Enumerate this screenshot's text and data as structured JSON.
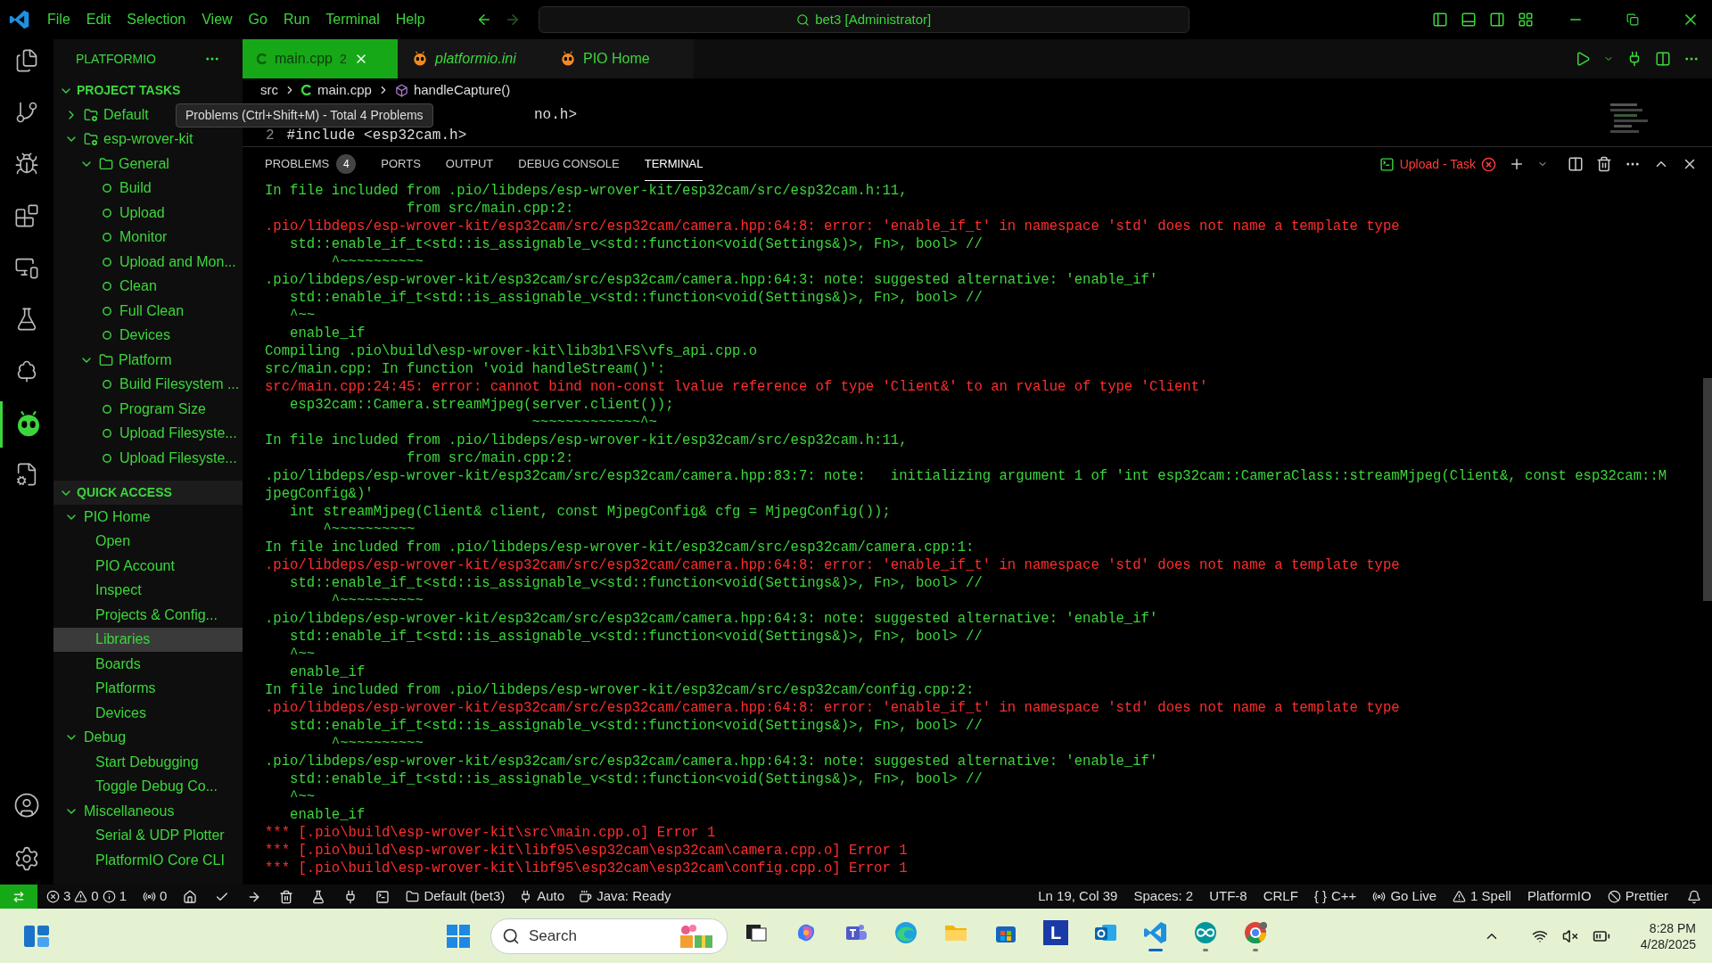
{
  "menu": [
    "File",
    "Edit",
    "Selection",
    "View",
    "Go",
    "Run",
    "Terminal",
    "Help"
  ],
  "command_center": "bet3 [Administrator]",
  "sidebar": {
    "title": "PLATFORMIO",
    "sections": [
      {
        "title": "PROJECT TASKS",
        "expanded": true,
        "items": [
          {
            "kind": "env",
            "label": "Default",
            "expanded": false,
            "selected": false
          },
          {
            "kind": "env",
            "label": "esp-wrover-kit",
            "expanded": true,
            "selected": false,
            "children": [
              {
                "kind": "folder",
                "label": "General",
                "expanded": true,
                "selected": false,
                "children": [
                  {
                    "kind": "task",
                    "label": "Build",
                    "selected": false
                  },
                  {
                    "kind": "task",
                    "label": "Upload",
                    "selected": false
                  },
                  {
                    "kind": "task",
                    "label": "Monitor",
                    "selected": false
                  },
                  {
                    "kind": "task",
                    "label": "Upload and Mon...",
                    "selected": false
                  },
                  {
                    "kind": "task",
                    "label": "Clean",
                    "selected": false
                  },
                  {
                    "kind": "task",
                    "label": "Full Clean",
                    "selected": false
                  },
                  {
                    "kind": "task",
                    "label": "Devices",
                    "selected": false
                  }
                ]
              },
              {
                "kind": "folder",
                "label": "Platform",
                "expanded": true,
                "selected": false,
                "children": [
                  {
                    "kind": "task",
                    "label": "Build Filesystem ...",
                    "selected": false
                  },
                  {
                    "kind": "task",
                    "label": "Program Size",
                    "selected": false
                  },
                  {
                    "kind": "task",
                    "label": "Upload Filesyste...",
                    "selected": false
                  },
                  {
                    "kind": "task",
                    "label": "Upload Filesyste...",
                    "selected": false
                  }
                ]
              }
            ]
          }
        ]
      },
      {
        "title": "QUICK ACCESS",
        "expanded": true,
        "items": [
          {
            "kind": "group",
            "label": "PIO Home",
            "expanded": true,
            "selected": false,
            "children": [
              {
                "kind": "link",
                "label": "Open",
                "selected": false
              },
              {
                "kind": "link",
                "label": "PIO Account",
                "selected": false
              },
              {
                "kind": "link",
                "label": "Inspect",
                "selected": false
              },
              {
                "kind": "link",
                "label": "Projects & Config...",
                "selected": false
              },
              {
                "kind": "link",
                "label": "Libraries",
                "selected": true
              },
              {
                "kind": "link",
                "label": "Boards",
                "selected": false
              },
              {
                "kind": "link",
                "label": "Platforms",
                "selected": false
              },
              {
                "kind": "link",
                "label": "Devices",
                "selected": false
              }
            ]
          },
          {
            "kind": "group",
            "label": "Debug",
            "expanded": true,
            "selected": false,
            "children": [
              {
                "kind": "link",
                "label": "Start Debugging",
                "selected": false
              },
              {
                "kind": "link",
                "label": "Toggle Debug Co...",
                "selected": false
              }
            ]
          },
          {
            "kind": "group",
            "label": "Miscellaneous",
            "expanded": true,
            "selected": false,
            "children": [
              {
                "kind": "link",
                "label": "Serial & UDP Plotter",
                "selected": false
              },
              {
                "kind": "link",
                "label": "PlatformIO Core CLI",
                "selected": false
              }
            ]
          }
        ]
      }
    ]
  },
  "editor_tabs": [
    {
      "kind": "cpp",
      "label": "main.cpp",
      "badge": "2",
      "selected": true,
      "preview": false
    },
    {
      "kind": "pio",
      "label": "platformio.ini",
      "selected": false,
      "preview": true
    },
    {
      "kind": "pio",
      "label": "PIO Home",
      "selected": false,
      "preview": false
    }
  ],
  "breadcrumb": [
    "src",
    "main.cpp",
    "handleCapture()"
  ],
  "editor_lines": [
    {
      "text": "no.h>"
    },
    {
      "number": "2",
      "text": "#include <esp32cam.h>"
    }
  ],
  "tooltip": "Problems (Ctrl+Shift+M) - Total 4 Problems",
  "panel_tabs": [
    {
      "label": "PROBLEMS",
      "badge": "4",
      "selected": false
    },
    {
      "label": "PORTS",
      "selected": false
    },
    {
      "label": "OUTPUT",
      "selected": false
    },
    {
      "label": "DEBUG CONSOLE",
      "selected": false
    },
    {
      "label": "TERMINAL",
      "selected": true
    }
  ],
  "terminal_task": "Upload - Task",
  "terminal": [
    {
      "kind": "normal",
      "text": "In file included from .pio/libdeps/esp-wrover-kit/esp32cam/src/esp32cam.h:11,"
    },
    {
      "kind": "normal",
      "text": "                 from src/main.cpp:2:"
    },
    {
      "kind": "error",
      "text": ".pio/libdeps/esp-wrover-kit/esp32cam/src/esp32cam/camera.hpp:64:8: error: 'enable_if_t' in namespace 'std' does not name a template type"
    },
    {
      "kind": "normal",
      "text": "   std::enable_if_t<std::is_assignable_v<std::function<void(Settings&)>, Fn>, bool> //"
    },
    {
      "kind": "normal",
      "text": "        ^~~~~~~~~~~"
    },
    {
      "kind": "normal",
      "text": ".pio/libdeps/esp-wrover-kit/esp32cam/src/esp32cam/camera.hpp:64:3: note: suggested alternative: 'enable_if'"
    },
    {
      "kind": "normal",
      "text": "   std::enable_if_t<std::is_assignable_v<std::function<void(Settings&)>, Fn>, bool> //"
    },
    {
      "kind": "normal",
      "text": "   ^~~"
    },
    {
      "kind": "normal",
      "text": "   enable_if"
    },
    {
      "kind": "normal",
      "text": "Compiling .pio\\build\\esp-wrover-kit\\lib3b1\\FS\\vfs_api.cpp.o"
    },
    {
      "kind": "normal",
      "text": "src/main.cpp: In function 'void handleStream()':"
    },
    {
      "kind": "error",
      "text": "src/main.cpp:24:45: error: cannot bind non-const lvalue reference of type 'Client&' to an rvalue of type 'Client'"
    },
    {
      "kind": "normal",
      "text": "   esp32cam::Camera.streamMjpeg(server.client());"
    },
    {
      "kind": "normal",
      "text": "                                ~~~~~~~~~~~~~^~"
    },
    {
      "kind": "normal",
      "text": "In file included from .pio/libdeps/esp-wrover-kit/esp32cam/src/esp32cam.h:11,"
    },
    {
      "kind": "normal",
      "text": "                 from src/main.cpp:2:"
    },
    {
      "kind": "normal",
      "text": ".pio/libdeps/esp-wrover-kit/esp32cam/src/esp32cam/camera.hpp:83:7: note:   initializing argument 1 of 'int esp32cam::CameraClass::streamMjpeg(Client&, const esp32cam::M"
    },
    {
      "kind": "normal",
      "text": "jpegConfig&)'"
    },
    {
      "kind": "normal",
      "text": "   int streamMjpeg(Client& client, const MjpegConfig& cfg = MjpegConfig());"
    },
    {
      "kind": "normal",
      "text": "       ^~~~~~~~~~~"
    },
    {
      "kind": "normal",
      "text": "In file included from .pio/libdeps/esp-wrover-kit/esp32cam/src/esp32cam/camera.cpp:1:"
    },
    {
      "kind": "error",
      "text": ".pio/libdeps/esp-wrover-kit/esp32cam/src/esp32cam/camera.hpp:64:8: error: 'enable_if_t' in namespace 'std' does not name a template type"
    },
    {
      "kind": "normal",
      "text": "   std::enable_if_t<std::is_assignable_v<std::function<void(Settings&)>, Fn>, bool> //"
    },
    {
      "kind": "normal",
      "text": "        ^~~~~~~~~~~"
    },
    {
      "kind": "normal",
      "text": ".pio/libdeps/esp-wrover-kit/esp32cam/src/esp32cam/camera.hpp:64:3: note: suggested alternative: 'enable_if'"
    },
    {
      "kind": "normal",
      "text": "   std::enable_if_t<std::is_assignable_v<std::function<void(Settings&)>, Fn>, bool> //"
    },
    {
      "kind": "normal",
      "text": "   ^~~"
    },
    {
      "kind": "normal",
      "text": "   enable_if"
    },
    {
      "kind": "normal",
      "text": "In file included from .pio/libdeps/esp-wrover-kit/esp32cam/src/esp32cam/config.cpp:2:"
    },
    {
      "kind": "error",
      "text": ".pio/libdeps/esp-wrover-kit/esp32cam/src/esp32cam/camera.hpp:64:8: error: 'enable_if_t' in namespace 'std' does not name a template type"
    },
    {
      "kind": "normal",
      "text": "   std::enable_if_t<std::is_assignable_v<std::function<void(Settings&)>, Fn>, bool> //"
    },
    {
      "kind": "normal",
      "text": "        ^~~~~~~~~~~"
    },
    {
      "kind": "normal",
      "text": ".pio/libdeps/esp-wrover-kit/esp32cam/src/esp32cam/camera.hpp:64:3: note: suggested alternative: 'enable_if'"
    },
    {
      "kind": "normal",
      "text": "   std::enable_if_t<std::is_assignable_v<std::function<void(Settings&)>, Fn>, bool> //"
    },
    {
      "kind": "normal",
      "text": "   ^~~"
    },
    {
      "kind": "normal",
      "text": "   enable_if"
    },
    {
      "kind": "error",
      "text": "*** [.pio\\build\\esp-wrover-kit\\src\\main.cpp.o] Error 1"
    },
    {
      "kind": "error",
      "text": "*** [.pio\\build\\esp-wrover-kit\\libf95\\esp32cam\\esp32cam\\camera.cpp.o] Error 1"
    },
    {
      "kind": "error",
      "text": "*** [.pio\\build\\esp-wrover-kit\\libf95\\esp32cam\\esp32cam\\config.cpp.o] Error 1"
    }
  ],
  "status_bar": {
    "errors": "3",
    "warnings": "0",
    "infos": "1",
    "ports": "0",
    "env": "Default (bet3)",
    "auto": "Auto",
    "java": "Java: Ready",
    "right": [
      {
        "kind": "text",
        "label": "Ln 19, Col 39"
      },
      {
        "kind": "text",
        "label": "Spaces: 2"
      },
      {
        "kind": "text",
        "label": "UTF-8"
      },
      {
        "kind": "text",
        "label": "CRLF"
      },
      {
        "kind": "braces",
        "icon": "{ }",
        "label": "C++"
      },
      {
        "kind": "live",
        "label": "Go Live"
      },
      {
        "kind": "warn",
        "label": "1 Spell"
      },
      {
        "kind": "text",
        "label": "PlatformIO"
      },
      {
        "kind": "prettier",
        "label": "Prettier"
      }
    ]
  },
  "taskbar": {
    "search_placeholder": "Search",
    "time": "8:28 PM",
    "date": "4/28/2025",
    "apps": [
      {
        "kind": "taskview",
        "running": false
      },
      {
        "kind": "copilot",
        "running": false
      },
      {
        "kind": "teams",
        "running": false
      },
      {
        "kind": "edge",
        "running": false
      },
      {
        "kind": "explorer",
        "running": false
      },
      {
        "kind": "store",
        "running": false
      },
      {
        "kind": "letter",
        "label": "L",
        "running": false
      },
      {
        "kind": "outlook",
        "running": false
      },
      {
        "kind": "vscode",
        "running": true
      },
      {
        "kind": "arduino",
        "running": true
      },
      {
        "kind": "chrome",
        "running": true
      }
    ]
  }
}
